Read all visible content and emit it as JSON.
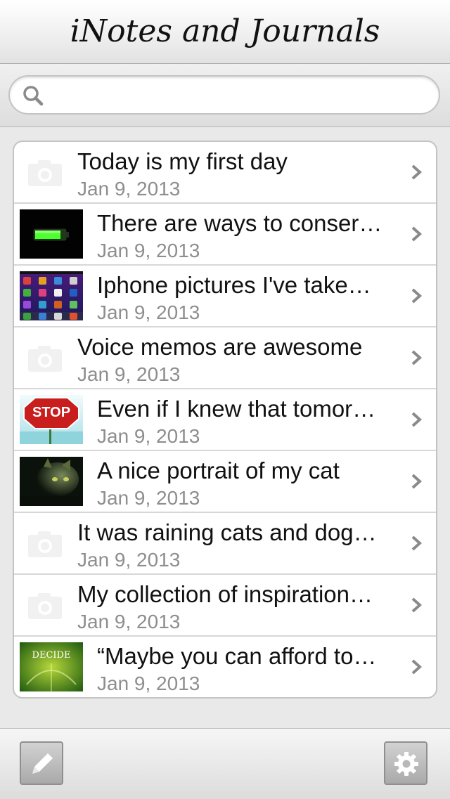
{
  "header": {
    "title": "iNotes and Journals"
  },
  "search": {
    "placeholder": ""
  },
  "entries": [
    {
      "title": "Today is my first day",
      "date": "Jan 9, 2013",
      "thumbnail": "camera-placeholder"
    },
    {
      "title": "There are ways to conser…",
      "date": "Jan 9, 2013",
      "thumbnail": "battery-photo"
    },
    {
      "title": "Iphone pictures I've take…",
      "date": "Jan 9, 2013",
      "thumbnail": "homescreen-photo"
    },
    {
      "title": "Voice memos are awesome",
      "date": "Jan 9, 2013",
      "thumbnail": "camera-placeholder"
    },
    {
      "title": "Even if I knew that tomor…",
      "date": "Jan 9, 2013",
      "thumbnail": "stop-sign-photo"
    },
    {
      "title": "A nice portrait of my cat",
      "date": "Jan 9, 2013",
      "thumbnail": "cat-photo"
    },
    {
      "title": "It was raining cats and dog…",
      "date": "Jan 9, 2013",
      "thumbnail": "camera-placeholder"
    },
    {
      "title": "My collection of inspiration…",
      "date": "Jan 9, 2013",
      "thumbnail": "camera-placeholder"
    },
    {
      "title": "“Maybe you can afford to…",
      "date": "Jan 9, 2013",
      "thumbnail": "decide-photo"
    }
  ],
  "toolbar": {
    "left_icon": "pencil-icon",
    "right_icon": "gear-icon"
  },
  "colors": {
    "title_text": "#111111",
    "date_text": "#8e8e8e",
    "chevron": "#8a8a8a"
  }
}
